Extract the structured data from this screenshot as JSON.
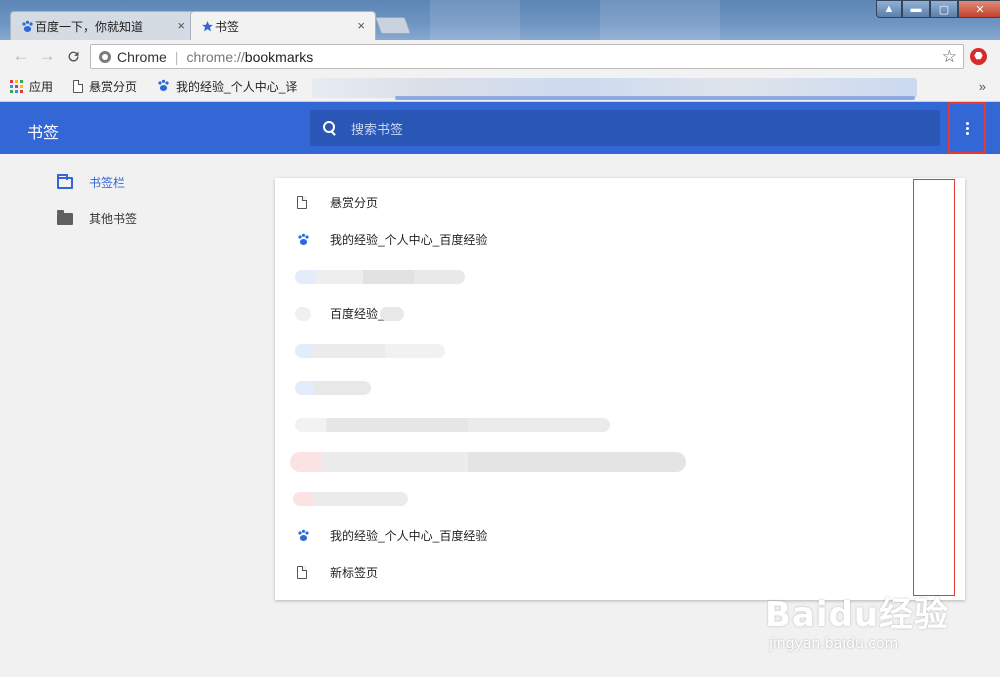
{
  "tabs": [
    {
      "title": "百度一下，你就知道",
      "close": "×"
    },
    {
      "title": "书签",
      "close": "×"
    }
  ],
  "window_controls": {
    "restore": "▲",
    "minimize": "▬",
    "maximize": "▢",
    "close": "✕"
  },
  "toolbar": {
    "back": "←",
    "forward": "→",
    "reload": "C",
    "site_label": "Chrome",
    "url_scheme": "chrome://",
    "url_host": "bookmarks",
    "star": "☆",
    "extension": "⬣"
  },
  "bookmarks_bar": {
    "items": [
      {
        "label": "应用",
        "icon": "apps-icon"
      },
      {
        "label": "悬赏分页",
        "icon": "page-icon"
      },
      {
        "label": "我的经验_个人中心_译",
        "icon": "baidu-paw-icon"
      }
    ],
    "more": "»"
  },
  "header": {
    "title": "书签",
    "search_placeholder": "搜索书签"
  },
  "sidebar": {
    "items": [
      {
        "label": "书签栏",
        "selected": true
      },
      {
        "label": "其他书签",
        "selected": false
      }
    ]
  },
  "bookmarks": [
    {
      "title": "悬赏分页",
      "icon": "page-icon"
    },
    {
      "title": "我的经验_个人中心_百度经验",
      "icon": "baidu-paw-icon"
    },
    {
      "title": "",
      "icon": "blurred"
    },
    {
      "title": "百度经验_",
      "icon": "blurred"
    },
    {
      "title": "",
      "icon": "blurred"
    },
    {
      "title": "",
      "icon": "blurred"
    },
    {
      "title": "",
      "icon": "blurred"
    },
    {
      "title": "",
      "icon": "blurred"
    },
    {
      "title": "",
      "icon": "blurred"
    },
    {
      "title": "我的经验_个人中心_百度经验",
      "icon": "baidu-paw-icon"
    },
    {
      "title": "新标签页",
      "icon": "page-icon"
    }
  ],
  "watermark": {
    "brand": "Baidu经验",
    "url": "jingyan.baidu.com"
  },
  "colors": {
    "header_blue": "#3367d6",
    "search_blue": "#2a56b5",
    "highlight_red": "#e53935"
  }
}
